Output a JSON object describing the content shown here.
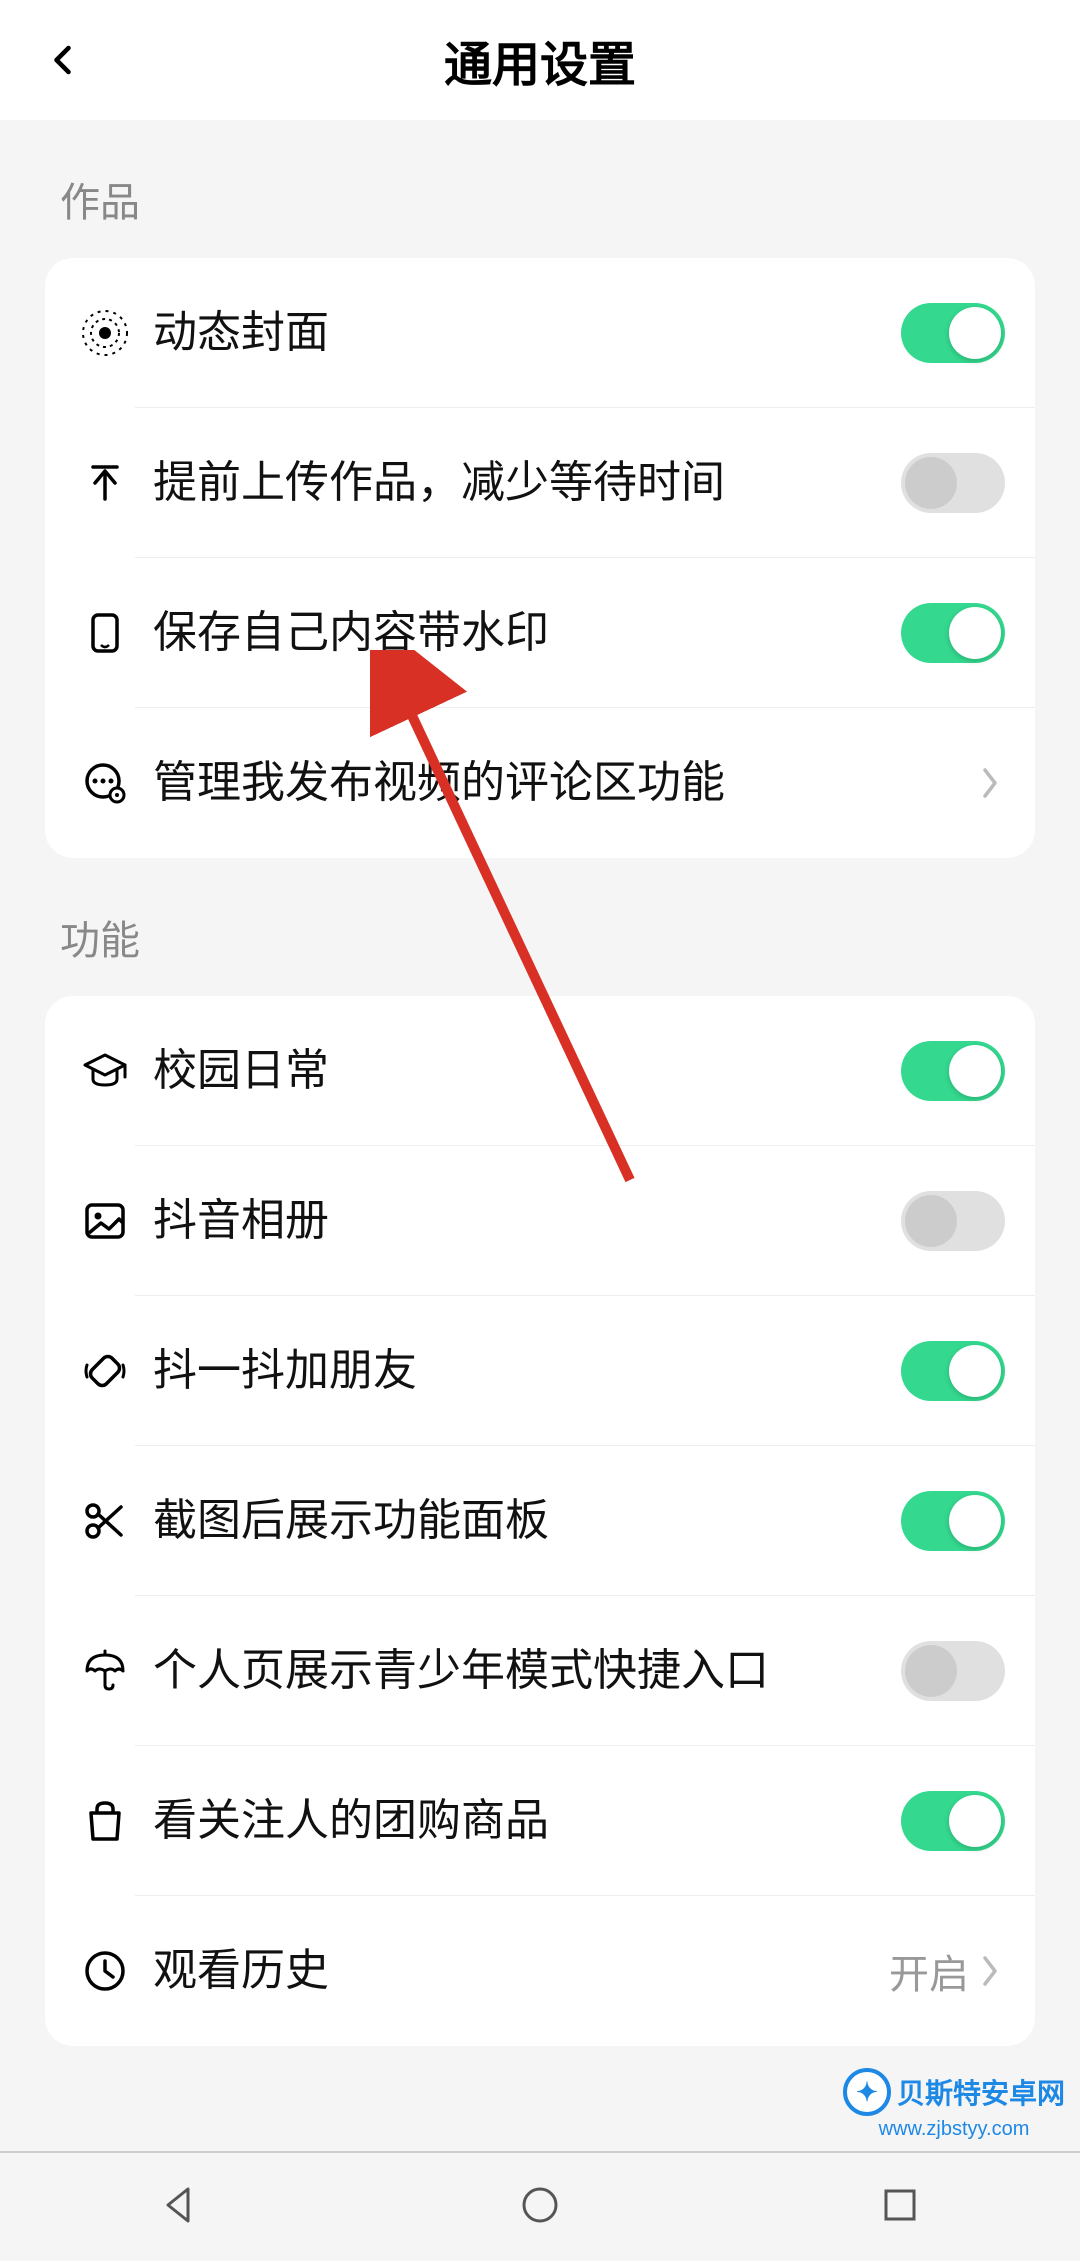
{
  "header": {
    "title": "通用设置"
  },
  "sections": {
    "works": {
      "label": "作品",
      "items": [
        {
          "label": "动态封面",
          "toggle": true
        },
        {
          "label": "提前上传作品，减少等待时间",
          "toggle": false
        },
        {
          "label": "保存自己内容带水印",
          "toggle": true
        },
        {
          "label": "管理我发布视频的评论区功能",
          "nav": true
        }
      ]
    },
    "features": {
      "label": "功能",
      "items": [
        {
          "label": "校园日常",
          "toggle": true
        },
        {
          "label": "抖音相册",
          "toggle": false
        },
        {
          "label": "抖一抖加朋友",
          "toggle": true
        },
        {
          "label": "截图后展示功能面板",
          "toggle": true
        },
        {
          "label": "个人页展示青少年模式快捷入口",
          "toggle": false
        },
        {
          "label": "看关注人的团购商品",
          "toggle": true
        },
        {
          "label": "观看历史",
          "value": "开启",
          "nav": true
        }
      ]
    }
  },
  "watermark": {
    "name": "贝斯特安卓网",
    "url": "www.zjbstyy.com"
  }
}
